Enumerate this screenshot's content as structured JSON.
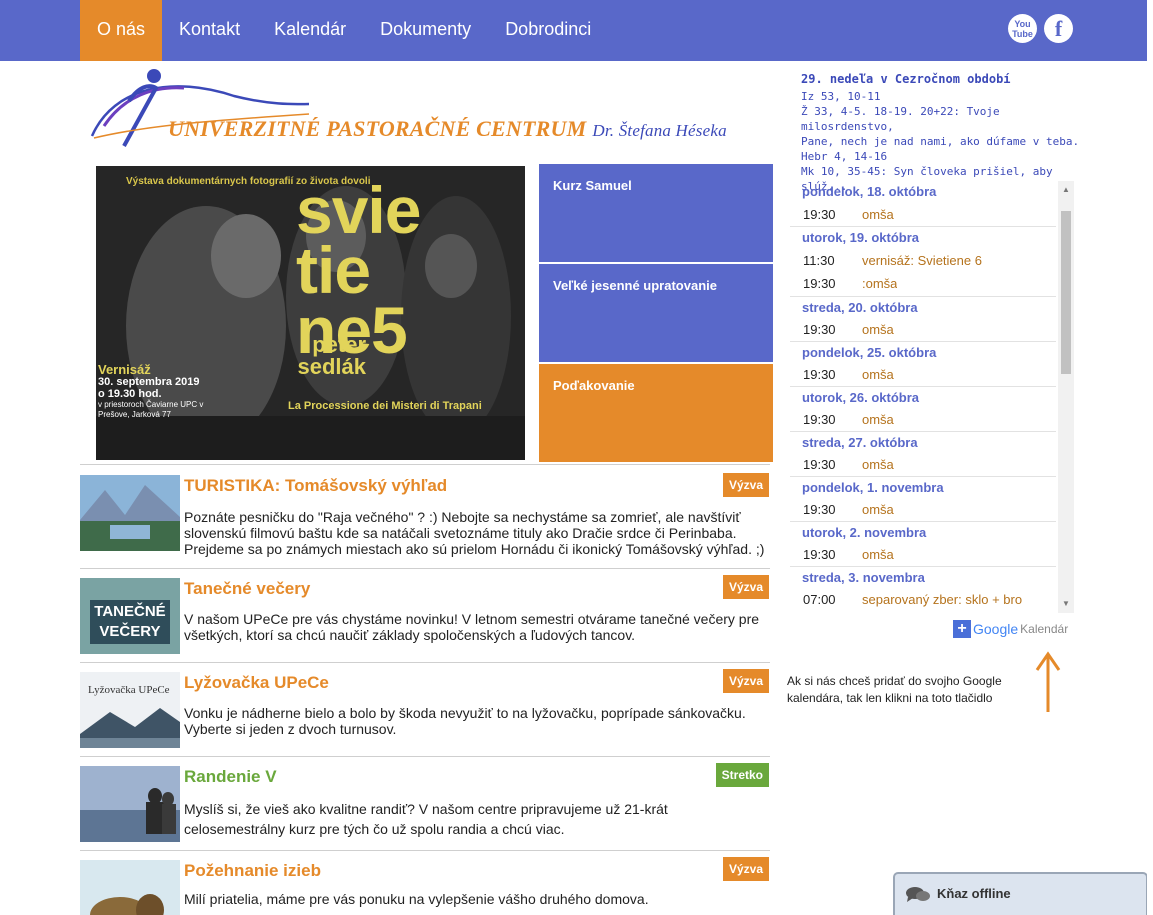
{
  "nav": {
    "items": [
      "O nás",
      "Kontakt",
      "Kalendár",
      "Dokumenty",
      "Dobrodinci"
    ],
    "active_index": 0,
    "social": {
      "youtube_label": "You Tube",
      "facebook_label": "f"
    }
  },
  "logo": {
    "title": "Univerzitné Pastoračné Centrum",
    "subtitle": "Dr. Štefana Héseka"
  },
  "poster": {
    "top_line": "Výstava dokumentárnych fotografií zo života dovoli",
    "big_text": "svie tie ne5",
    "author": "peter sedlák",
    "subtitle": "La Processione dei Misteri di Trapani",
    "vernisaz": "Vernisáž",
    "date": "30. septembra 2019",
    "time": "o 19.30 hod.",
    "place": "v priestoroch Čaviarne UPC v Prešove, Jarková 77"
  },
  "tiles": [
    "Kurz Samuel",
    "Veľké jesenné upratovanie",
    "Poďakovanie"
  ],
  "articles": [
    {
      "title": "TURISTIKA: Tomášovský výhľad",
      "badge": "Výzva",
      "text": "Poznáte pesničku do \"Raja večného\" ? :) Nebojte sa nechystáme sa zomrieť, ale navštíviť slovenskú filmovú baštu kde sa natáčali svetoznáme tituly ako Dračie srdce či Perinbaba. Prejdeme sa po známych miestach ako sú prielom Hornádu či ikonický Tomášovský výhľad. ;)"
    },
    {
      "title": "Tanečné večery",
      "badge": "Výzva",
      "img_text": "TANEČNÉ VEČERY",
      "text": "V našom UPeCe pre vás chystáme novinku! V letnom semestri otvárame tanečné večery pre všetkých, ktorí sa chcú naučiť základy spoločenských a ľudových tancov."
    },
    {
      "title": "Lyžovačka UPeCe",
      "badge": "Výzva",
      "img_text": "Lyžovačka UPeCe",
      "text": "Vonku je nádherne bielo a bolo by škoda nevyužiť to na lyžovačku, poprípade sánkovačku. Vyberte si jeden z dvoch turnusov."
    },
    {
      "title": "Randenie V",
      "badge": "Stretko",
      "text": "Myslíš si, že vieš ako kvalitne randiť? V našom centre pripravujeme už 21-krát celosemestrálny kurz pre tých čo už spolu randia a chcú viac."
    },
    {
      "title": "Požehnanie izieb",
      "badge": "Výzva",
      "text": "Milí priatelia, máme pre vás ponuku na vylepšenie vášho druhého domova."
    }
  ],
  "liturgy": {
    "title": "29. nedeľa v Cezročnom období",
    "lines": [
      "Iz 53, 10-11",
      "Ž 33, 4-5. 18-19. 20+22: Tvoje milosrdenstvo,",
      "Pane, nech je nad nami, ako dúfame v teba.",
      "Hebr 4, 14-16",
      "Mk 10, 35-45: Syn človeka prišiel, aby slúž..."
    ]
  },
  "calendar": {
    "days": [
      {
        "date": "pondelok, 18. októbra",
        "events": [
          {
            "time": "19:30",
            "name": "omša"
          }
        ]
      },
      {
        "date": "utorok, 19. októbra",
        "events": [
          {
            "time": "11:30",
            "name": "vernisáž: Svietiene 6"
          },
          {
            "time": "19:30",
            "name": ":omša"
          }
        ]
      },
      {
        "date": "streda, 20. októbra",
        "events": [
          {
            "time": "19:30",
            "name": "omša"
          }
        ]
      },
      {
        "date": "pondelok, 25. októbra",
        "events": [
          {
            "time": "19:30",
            "name": "omša"
          }
        ]
      },
      {
        "date": "utorok, 26. októbra",
        "events": [
          {
            "time": "19:30",
            "name": "omša"
          }
        ]
      },
      {
        "date": "streda, 27. októbra",
        "events": [
          {
            "time": "19:30",
            "name": "omša"
          }
        ]
      },
      {
        "date": "pondelok, 1. novembra",
        "events": [
          {
            "time": "19:30",
            "name": "omša"
          }
        ]
      },
      {
        "date": "utorok, 2. novembra",
        "events": [
          {
            "time": "19:30",
            "name": "omša"
          }
        ]
      },
      {
        "date": "streda, 3. novembra",
        "events": [
          {
            "time": "07:00",
            "name": "separovaný zber: sklo + bro"
          }
        ]
      }
    ],
    "google_label": "Google",
    "kalendar_label": "Kalendár",
    "hint": "Ak si nás chceš pridať do svojho Google kalendára, tak len klikni na toto tlačidlo"
  },
  "chat": {
    "label": "Kňaz offline"
  },
  "colors": {
    "blue": "#5968c9",
    "orange": "#e58a2a",
    "green": "#6aa83c"
  }
}
